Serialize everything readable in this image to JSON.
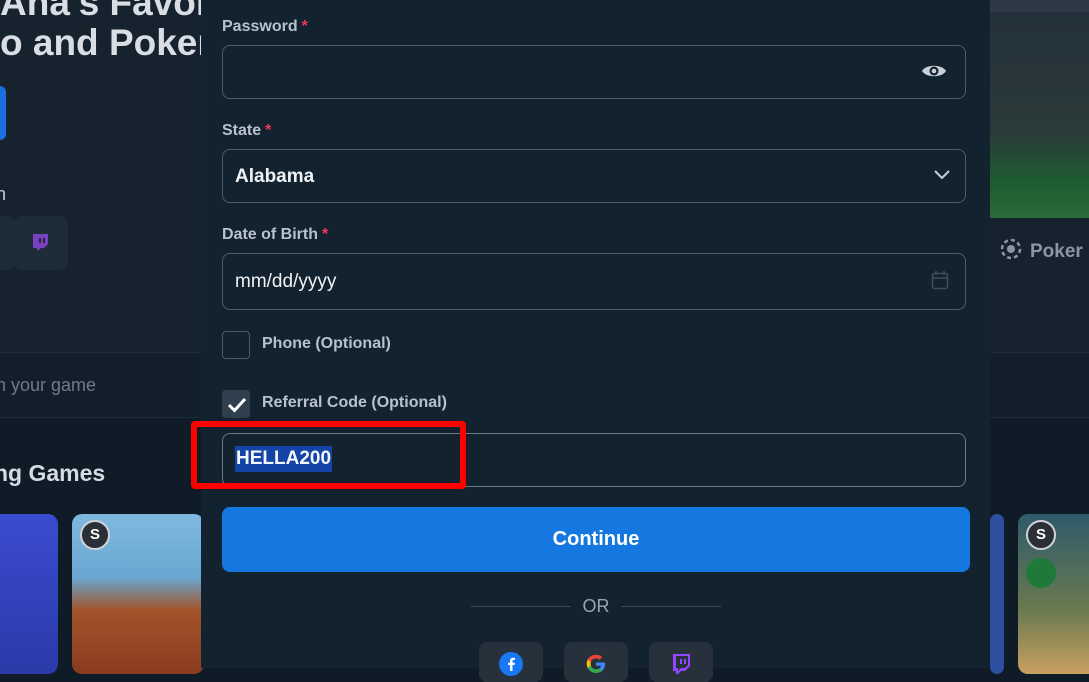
{
  "background": {
    "hero_line1": "Ana's Favorite",
    "hero_line2": "o and Poker",
    "hero_fragment": "n",
    "poker_tab": "Poker",
    "search_placeholder": "h your game",
    "section_title": "ng Games",
    "badge_letter": "S"
  },
  "form": {
    "password": {
      "label": "Password",
      "required_mark": "*",
      "value": ""
    },
    "state": {
      "label": "State",
      "required_mark": "*",
      "value": "Alabama"
    },
    "dob": {
      "label": "Date of Birth",
      "required_mark": "*",
      "placeholder": "mm/dd/yyyy"
    },
    "phone": {
      "label": "Phone (Optional)",
      "checked": false
    },
    "referral": {
      "label": "Referral Code (Optional)",
      "checked": true,
      "value": "HELLA200"
    },
    "continue_label": "Continue",
    "or_label": "OR"
  },
  "social_logins": [
    "facebook-icon",
    "google-icon",
    "twitch-icon"
  ],
  "colors": {
    "accent": "#1478e0",
    "required": "#f0384f",
    "highlight": "#ff0000",
    "modal_bg": "#13222f"
  }
}
